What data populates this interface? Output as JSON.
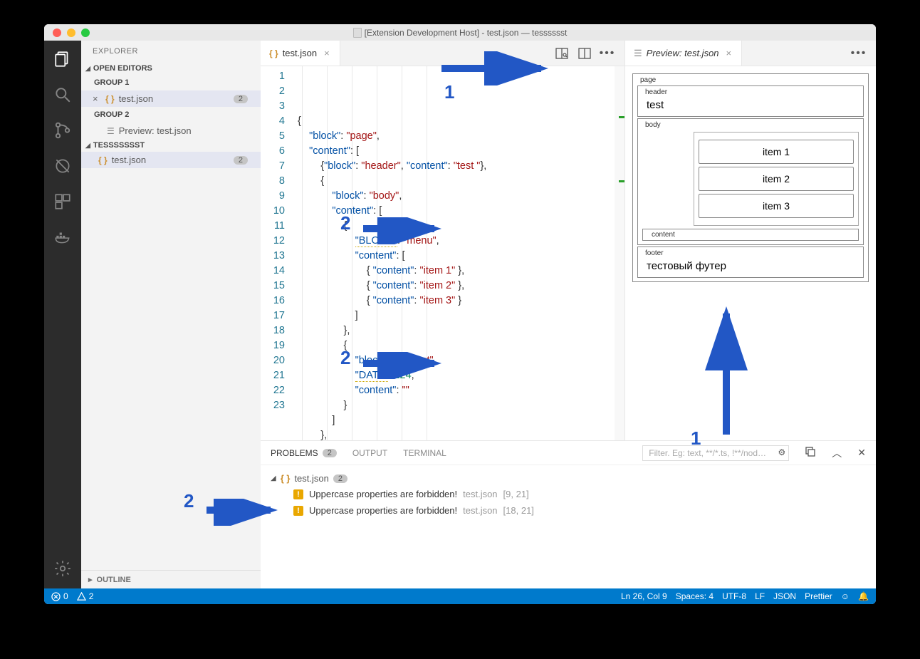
{
  "window": {
    "title": "[Extension Development Host] - test.json — tesssssst"
  },
  "activitybar": {
    "items": [
      "explorer",
      "search",
      "scm",
      "debug",
      "extensions",
      "docker"
    ]
  },
  "sidebar": {
    "title": "EXPLORER",
    "openEditors": {
      "label": "OPEN EDITORS",
      "groups": [
        {
          "name": "GROUP 1",
          "files": [
            {
              "name": "test.json",
              "icon": "json",
              "problems": 2,
              "closeable": true
            }
          ]
        },
        {
          "name": "GROUP 2",
          "files": [
            {
              "name": "Preview: test.json",
              "icon": "preview"
            }
          ]
        }
      ]
    },
    "workspace": {
      "label": "TESSSSSSST",
      "files": [
        {
          "name": "test.json",
          "icon": "json",
          "problems": 2
        }
      ]
    },
    "outline": {
      "label": "OUTLINE"
    }
  },
  "editorLeft": {
    "tab": {
      "name": "test.json"
    },
    "code": {
      "lines": [
        "{",
        "    \"block\": \"page\",",
        "    \"content\": [",
        "        {\"block\": \"header\", \"content\": \"test \"},",
        "        {",
        "            \"block\": \"body\",",
        "            \"content\": [",
        "                {",
        "                    \"BLOCK\": \"menu\",",
        "                    \"content\": [",
        "                        { \"content\": \"item 1\" },",
        "                        { \"content\": \"item 2\" },",
        "                        { \"content\": \"item 3\" }",
        "                    ]",
        "                },",
        "                {",
        "                    \"block\": \"content\",",
        "                    \"DATA\": 124,",
        "                    \"content\": \"\"",
        "                }",
        "            ]",
        "        },",
        "        {"
      ]
    }
  },
  "editorRight": {
    "tab": {
      "name": "Preview: test.json"
    }
  },
  "preview": {
    "page": {
      "label": "page",
      "blocks": [
        {
          "label": "header",
          "text": "test"
        },
        {
          "label": "body",
          "items": [
            "item 1",
            "item 2",
            "item 3"
          ],
          "contentLabel": "content"
        },
        {
          "label": "footer",
          "text": "тестовый футер"
        }
      ]
    }
  },
  "panel": {
    "tabs": {
      "problems": "PROBLEMS",
      "output": "OUTPUT",
      "terminal": "TERMINAL",
      "problemsCount": 2
    },
    "filterPlaceholder": "Filter. Eg: text, **/*.ts, !**/nod…",
    "problems": {
      "file": "test.json",
      "count": 2,
      "items": [
        {
          "msg": "Uppercase properties are forbidden!",
          "file": "test.json",
          "loc": "[9, 21]"
        },
        {
          "msg": "Uppercase properties are forbidden!",
          "file": "test.json",
          "loc": "[18, 21]"
        }
      ]
    }
  },
  "statusbar": {
    "errors": 0,
    "warnings": 2,
    "cursor": "Ln 26, Col 9",
    "spaces": "Spaces: 4",
    "encoding": "UTF-8",
    "eol": "LF",
    "lang": "JSON",
    "formatter": "Prettier"
  },
  "annotations": {
    "one": "1",
    "two": "2"
  }
}
